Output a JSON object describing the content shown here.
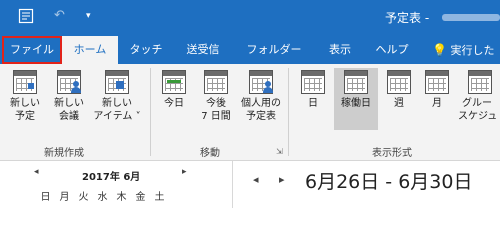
{
  "window": {
    "title": "予定表 -",
    "title_redacted": true
  },
  "quick_access": {
    "undo_icon": "undo-icon",
    "customize_icon": "chevron-down-icon",
    "sync_icon": "send-receive-icon"
  },
  "tabs": [
    {
      "label": "ファイル",
      "highlighted": true
    },
    {
      "label": "ホーム",
      "selected": true
    },
    {
      "label": "タッチ"
    },
    {
      "label": "送受信"
    },
    {
      "label": "フォルダー"
    },
    {
      "label": "表示"
    },
    {
      "label": "ヘルプ"
    },
    {
      "label": "実行した"
    }
  ],
  "ribbon": {
    "groups": [
      {
        "label": "新規作成",
        "buttons": [
          {
            "label1": "新しい",
            "label2": "予定"
          },
          {
            "label1": "新しい",
            "label2": "会議"
          },
          {
            "label1": "新しい",
            "label2": "アイテム ˅"
          }
        ]
      },
      {
        "label": "移動",
        "buttons": [
          {
            "label1": "今日",
            "label2": ""
          },
          {
            "label1": "今後",
            "label2": "7 日間"
          },
          {
            "label1": "個人用の",
            "label2": "予定表"
          }
        ]
      },
      {
        "label": "表示形式",
        "buttons": [
          {
            "label1": "日",
            "label2": ""
          },
          {
            "label1": "稼働日",
            "label2": "",
            "active": true
          },
          {
            "label1": "週",
            "label2": ""
          },
          {
            "label1": "月",
            "label2": ""
          },
          {
            "label1": "グルー",
            "label2": "スケジュ"
          }
        ]
      }
    ]
  },
  "mini_calendar": {
    "title": "2017年 6月",
    "prev": "◂",
    "next": "▸",
    "weekdays": [
      "日",
      "月",
      "火",
      "水",
      "木",
      "金",
      "土"
    ]
  },
  "main": {
    "prev": "◂",
    "next": "▸",
    "date_range": "6月26日 - 6月30日"
  },
  "colors": {
    "accent": "#1e6fc1",
    "highlight": "#e2231a",
    "ribbon_bg": "#f3f3f3"
  }
}
